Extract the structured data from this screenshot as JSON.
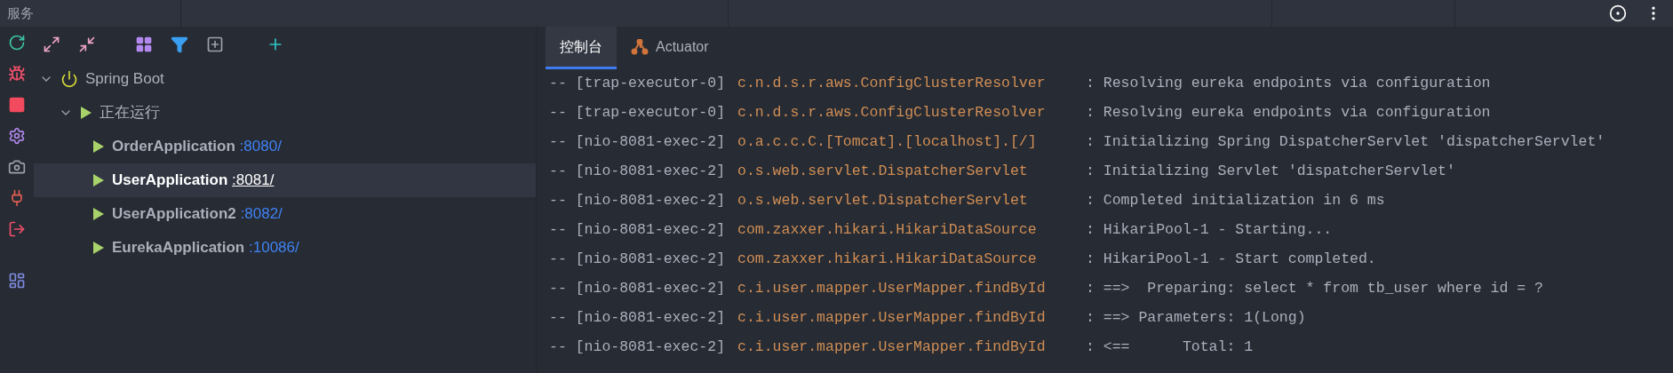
{
  "title_bar": {
    "title": "服务"
  },
  "tree": [
    {
      "label": "Spring Boot",
      "kind": "group",
      "expanded": true,
      "children": [
        {
          "label": "正在运行",
          "kind": "status",
          "expanded": true,
          "children": [
            {
              "label": "OrderApplication",
              "kind": "app",
              "port": ":8080/",
              "selected": false
            },
            {
              "label": "UserApplication",
              "kind": "app",
              "port": ":8081/",
              "selected": true
            },
            {
              "label": "UserApplication2",
              "kind": "app",
              "port": ":8082/",
              "selected": false
            },
            {
              "label": "EurekaApplication",
              "kind": "app",
              "port": ":10086/",
              "selected": false
            }
          ]
        }
      ]
    }
  ],
  "tabs": [
    {
      "label": "控制台",
      "kind": "console",
      "selected": true
    },
    {
      "label": "Actuator",
      "kind": "actuator",
      "selected": false
    }
  ],
  "log": [
    {
      "thread": "-- [trap-executor-0]",
      "logger": "c.n.d.s.r.aws.ConfigClusterResolver",
      "message": ": Resolving eureka endpoints via configuration"
    },
    {
      "thread": "-- [trap-executor-0]",
      "logger": "c.n.d.s.r.aws.ConfigClusterResolver",
      "message": ": Resolving eureka endpoints via configuration"
    },
    {
      "thread": "-- [nio-8081-exec-2]",
      "logger": "o.a.c.c.C.[Tomcat].[localhost].[/]",
      "message": ": Initializing Spring DispatcherServlet 'dispatcherServlet'"
    },
    {
      "thread": "-- [nio-8081-exec-2]",
      "logger": "o.s.web.servlet.DispatcherServlet",
      "message": ": Initializing Servlet 'dispatcherServlet'"
    },
    {
      "thread": "-- [nio-8081-exec-2]",
      "logger": "o.s.web.servlet.DispatcherServlet",
      "message": ": Completed initialization in 6 ms"
    },
    {
      "thread": "-- [nio-8081-exec-2]",
      "logger": "com.zaxxer.hikari.HikariDataSource",
      "message": ": HikariPool-1 - Starting..."
    },
    {
      "thread": "-- [nio-8081-exec-2]",
      "logger": "com.zaxxer.hikari.HikariDataSource",
      "message": ": HikariPool-1 - Start completed."
    },
    {
      "thread": "-- [nio-8081-exec-2]",
      "logger": "c.i.user.mapper.UserMapper.findById",
      "message": ": ==>  Preparing: select * from tb_user where id = ?"
    },
    {
      "thread": "-- [nio-8081-exec-2]",
      "logger": "c.i.user.mapper.UserMapper.findById",
      "message": ": ==> Parameters: 1(Long)"
    },
    {
      "thread": "-- [nio-8081-exec-2]",
      "logger": "c.i.user.mapper.UserMapper.findById",
      "message": ": <==      Total: 1"
    }
  ]
}
